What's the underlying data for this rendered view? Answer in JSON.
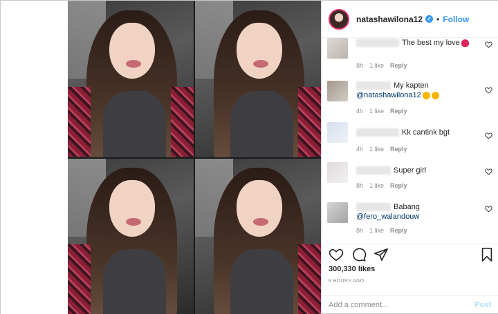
{
  "header": {
    "username": "natashawilona12",
    "verified_glyph": "✓",
    "separator": "•",
    "follow_label": "Follow"
  },
  "comments": [
    {
      "text": "The best my love",
      "emoji": "heart-emoji",
      "time": "8h",
      "likes": "1 like",
      "reply": "Reply"
    },
    {
      "text": "My kapten",
      "mention": "@natashawilona12",
      "emoji": "heart-eyes-emoji",
      "time": "4h",
      "likes": "1 like",
      "reply": "Reply"
    },
    {
      "text": "Kk cantink bgt",
      "time": "4h",
      "likes": "1 like",
      "reply": "Reply"
    },
    {
      "text": "Super girl",
      "time": "8h",
      "likes": "1 like",
      "reply": "Reply"
    },
    {
      "text": "Babang",
      "mention": "@fero_walandouw",
      "time": "8h",
      "likes": "1 like",
      "reply": "Reply"
    }
  ],
  "post": {
    "likes": "300,330 likes",
    "time_ago": "8 HOURS AGO"
  },
  "composer": {
    "placeholder": "Add a comment...",
    "post_label": "Post"
  },
  "colors": {
    "accent": "#3897f0",
    "mention": "#003569",
    "meta": "#8e8e8e",
    "post_disabled": "#b2dffc"
  }
}
